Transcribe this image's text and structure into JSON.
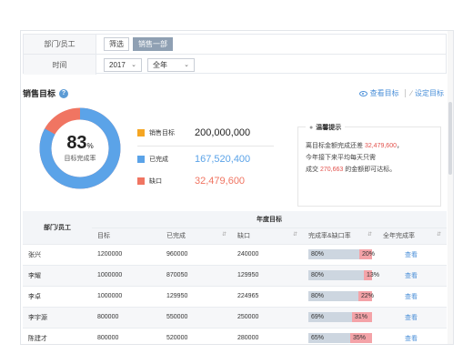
{
  "filter": {
    "dept_label": "部门/员工",
    "filter_button": "筛选",
    "selected_dept": "销售一部",
    "time_label": "时间",
    "year": "2017",
    "period": "全年"
  },
  "section": {
    "title": "销售目标",
    "view_target": "查看目标",
    "set_target": "设定目标"
  },
  "donut": {
    "percent": "83",
    "percent_unit": "%",
    "label": "目标完成率",
    "fraction": 0.83,
    "color_done": "#5ba3e8",
    "color_gap": "#f07562"
  },
  "stats": {
    "target_label": "销售目标",
    "target_value": "200,000,000",
    "done_label": "已完成",
    "done_value": "167,520,400",
    "gap_label": "缺口",
    "gap_value": "32,479,600",
    "target_color": "#f5a623",
    "done_color": "#5ba3e8",
    "gap_color": "#f07562"
  },
  "tip": {
    "title": "温馨提示",
    "line1_a": "离目标金额完成还差",
    "line1_red": "32,479,600",
    "line1_b": "，",
    "line2": "今年接下来平均每天只需",
    "line3_a": "成交",
    "line3_red": "270,663",
    "line3_b": "的金额即可达标。"
  },
  "table": {
    "col_dept": "部门/员工",
    "group_header": "年度目标",
    "col_target": "目标",
    "col_done": "已完成",
    "col_gap": "缺口",
    "col_rate": "完成率&缺口率",
    "col_year_rate": "全年完成率",
    "rows": [
      {
        "name": "张兴",
        "target": "1200000",
        "done": "960000",
        "gap": "240000",
        "rate": 0.8,
        "rate_text": "80%",
        "gap_text": "20%",
        "action": "查看"
      },
      {
        "name": "李耀",
        "target": "1000000",
        "done": "870050",
        "gap": "129950",
        "rate": 0.87,
        "rate_text": "80%",
        "gap_text": "13%",
        "action": "查看"
      },
      {
        "name": "李卓",
        "target": "1000000",
        "done": "129950",
        "gap": "224965",
        "rate": 0.78,
        "rate_text": "80%",
        "gap_text": "22%",
        "action": "查看"
      },
      {
        "name": "李宇源",
        "target": "800000",
        "done": "550000",
        "gap": "250000",
        "rate": 0.69,
        "rate_text": "69%",
        "gap_text": "31%",
        "action": "查看"
      },
      {
        "name": "陈建才",
        "target": "800000",
        "done": "520000",
        "gap": "280000",
        "rate": 0.65,
        "rate_text": "65%",
        "gap_text": "35%",
        "action": "查看"
      }
    ]
  }
}
